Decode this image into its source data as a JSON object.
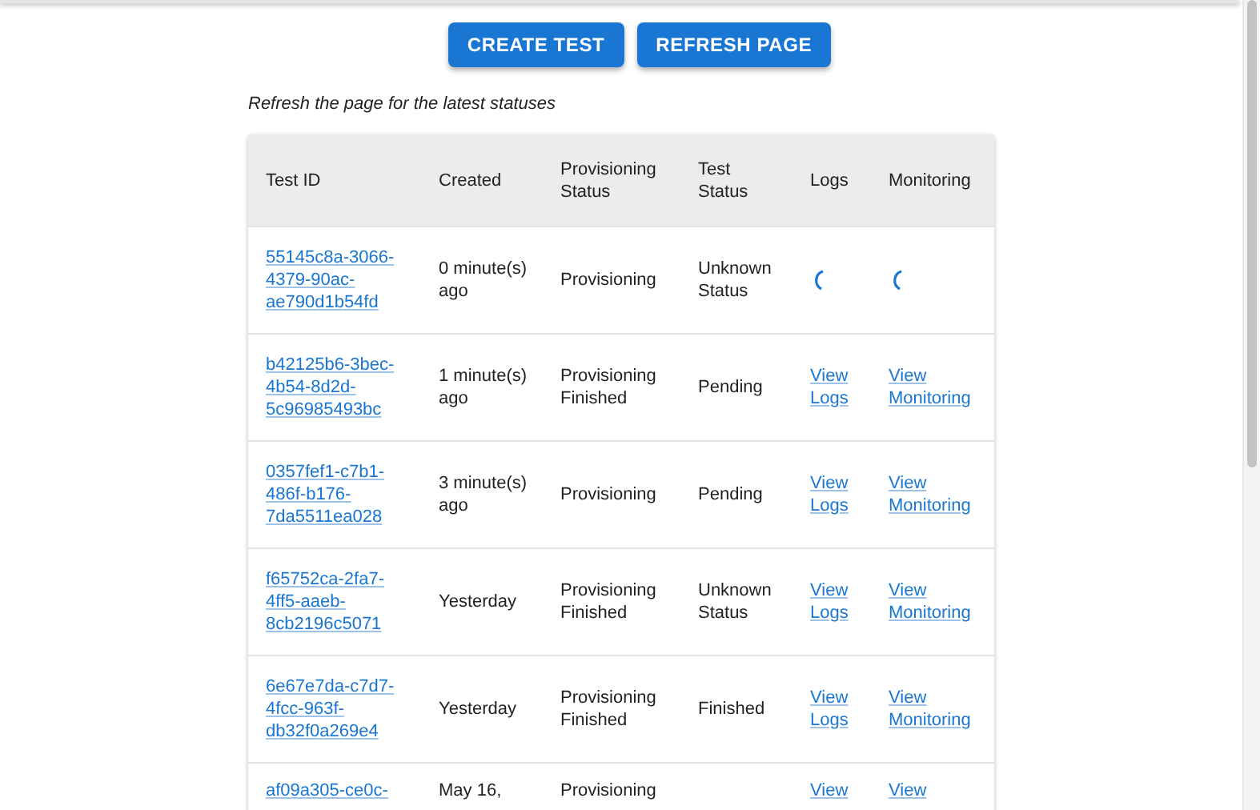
{
  "buttons": [
    {
      "label": "CREATE TEST"
    },
    {
      "label": "REFRESH PAGE"
    }
  ],
  "note": "Refresh the page for the latest statuses",
  "table": {
    "columns": [
      "Test ID",
      "Created",
      "Provisioning Status",
      "Test Status",
      "Logs",
      "Monitoring"
    ],
    "rows": [
      {
        "test_id": "55145c8a-3066-4379-90ac-ae790d1b54fd",
        "created": "0 minute(s) ago",
        "provisioning_status": "Provisioning",
        "test_status": "Unknown Status",
        "logs": {
          "kind": "loading"
        },
        "monitoring": {
          "kind": "loading"
        }
      },
      {
        "test_id": "b42125b6-3bec-4b54-8d2d-5c96985493bc",
        "created": "1 minute(s) ago",
        "provisioning_status": "Provisioning Finished",
        "test_status": "Pending",
        "logs": {
          "kind": "link",
          "text": "View Logs"
        },
        "monitoring": {
          "kind": "link",
          "text": "View Monitoring"
        }
      },
      {
        "test_id": "0357fef1-c7b1-486f-b176-7da5511ea028",
        "created": "3 minute(s) ago",
        "provisioning_status": "Provisioning",
        "test_status": "Pending",
        "logs": {
          "kind": "link",
          "text": "View Logs"
        },
        "monitoring": {
          "kind": "link",
          "text": "View Monitoring"
        }
      },
      {
        "test_id": "f65752ca-2fa7-4ff5-aaeb-8cb2196c5071",
        "created": "Yesterday",
        "provisioning_status": "Provisioning Finished",
        "test_status": "Unknown Status",
        "logs": {
          "kind": "link",
          "text": "View Logs"
        },
        "monitoring": {
          "kind": "link",
          "text": "View Monitoring"
        }
      },
      {
        "test_id": "6e67e7da-c7d7-4fcc-963f-db32f0a269e4",
        "created": "Yesterday",
        "provisioning_status": "Provisioning Finished",
        "test_status": "Finished",
        "logs": {
          "kind": "link",
          "text": "View Logs"
        },
        "monitoring": {
          "kind": "link",
          "text": "View Monitoring"
        }
      },
      {
        "test_id": "af09a305-ce0c-",
        "created": "May 16,",
        "provisioning_status": "Provisioning",
        "test_status": "",
        "logs": {
          "kind": "link",
          "text": "View"
        },
        "monitoring": {
          "kind": "link",
          "text": "View"
        }
      }
    ]
  }
}
